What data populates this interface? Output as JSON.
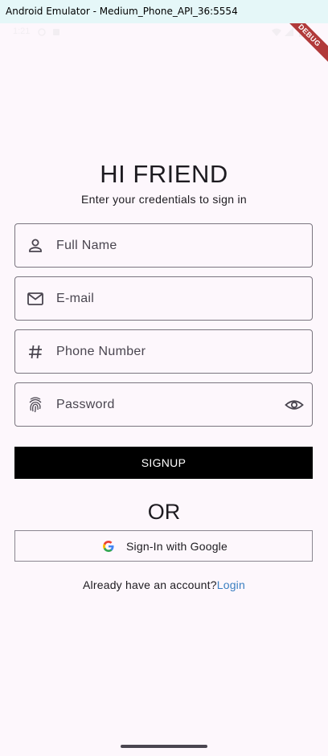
{
  "window": {
    "title": "Android Emulator - Medium_Phone_API_36:5554"
  },
  "status_bar": {
    "time": "1:21",
    "debug_label": "DEBUG"
  },
  "page": {
    "title": "HI FRIEND",
    "subtitle": "Enter your credentials to sign in"
  },
  "form": {
    "full_name": {
      "placeholder": "Full Name",
      "icon": "person-icon"
    },
    "email": {
      "placeholder": "E-mail",
      "icon": "mail-icon"
    },
    "phone": {
      "placeholder": "Phone Number",
      "icon": "hash-icon"
    },
    "password": {
      "placeholder": "Password",
      "icon": "fingerprint-icon",
      "trailing_icon": "eye-icon"
    },
    "signup_label": "SIGNUP"
  },
  "alt": {
    "or_label": "OR",
    "google_label": "Sign-In with Google"
  },
  "footer": {
    "prompt": "Already have an account?",
    "login_label": "Login"
  },
  "colors": {
    "background": "#fdf7fc",
    "button": "#000000",
    "link": "#3a7fc1",
    "titlebar": "#e5f7f8",
    "debug_banner": "#b13a3a"
  }
}
